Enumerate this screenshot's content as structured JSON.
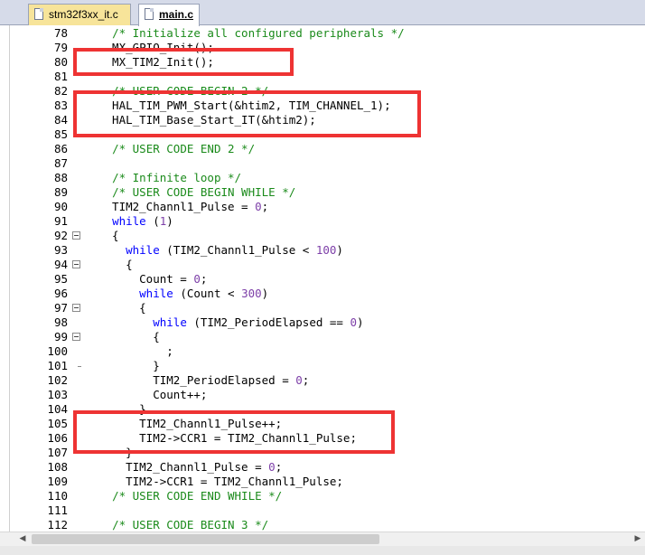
{
  "tabs": [
    {
      "label": "stm32f3xx_it.c",
      "active": false
    },
    {
      "label": "main.c",
      "active": true
    }
  ],
  "editor": {
    "lines": [
      {
        "num": "78",
        "fold": "",
        "segments": [
          {
            "t": "  ",
            "c": "plain"
          },
          {
            "t": "/* Initialize all configured peripherals */",
            "c": "comment"
          }
        ]
      },
      {
        "num": "79",
        "fold": "",
        "segments": [
          {
            "t": "  MX_GPIO_Init();",
            "c": "plain"
          }
        ]
      },
      {
        "num": "80",
        "fold": "",
        "segments": [
          {
            "t": "  MX_TIM2_Init();",
            "c": "plain"
          }
        ]
      },
      {
        "num": "81",
        "fold": "",
        "segments": [
          {
            "t": "",
            "c": "plain"
          }
        ]
      },
      {
        "num": "82",
        "fold": "",
        "segments": [
          {
            "t": "  ",
            "c": "plain"
          },
          {
            "t": "/* USER CODE BEGIN 2 */",
            "c": "comment"
          }
        ]
      },
      {
        "num": "83",
        "fold": "",
        "segments": [
          {
            "t": "  HAL_TIM_PWM_Start(&htim2, TIM_CHANNEL_1);",
            "c": "plain"
          }
        ]
      },
      {
        "num": "84",
        "fold": "",
        "segments": [
          {
            "t": "  HAL_TIM_Base_Start_IT(&htim2);",
            "c": "plain"
          }
        ]
      },
      {
        "num": "85",
        "fold": "",
        "segments": [
          {
            "t": "",
            "c": "plain"
          }
        ]
      },
      {
        "num": "86",
        "fold": "",
        "segments": [
          {
            "t": "  ",
            "c": "plain"
          },
          {
            "t": "/* USER CODE END 2 */",
            "c": "comment"
          }
        ]
      },
      {
        "num": "87",
        "fold": "",
        "segments": [
          {
            "t": "",
            "c": "plain"
          }
        ]
      },
      {
        "num": "88",
        "fold": "",
        "segments": [
          {
            "t": "  ",
            "c": "plain"
          },
          {
            "t": "/* Infinite loop */",
            "c": "comment"
          }
        ]
      },
      {
        "num": "89",
        "fold": "",
        "segments": [
          {
            "t": "  ",
            "c": "plain"
          },
          {
            "t": "/* USER CODE BEGIN WHILE */",
            "c": "comment"
          }
        ]
      },
      {
        "num": "90",
        "fold": "",
        "segments": [
          {
            "t": "  TIM2_Channl1_Pulse = ",
            "c": "plain"
          },
          {
            "t": "0",
            "c": "num"
          },
          {
            "t": ";",
            "c": "plain"
          }
        ]
      },
      {
        "num": "91",
        "fold": "",
        "segments": [
          {
            "t": "  ",
            "c": "plain"
          },
          {
            "t": "while",
            "c": "kw"
          },
          {
            "t": " (",
            "c": "plain"
          },
          {
            "t": "1",
            "c": "num"
          },
          {
            "t": ")",
            "c": "plain"
          }
        ]
      },
      {
        "num": "92",
        "fold": "open",
        "segments": [
          {
            "t": "  {",
            "c": "plain"
          }
        ]
      },
      {
        "num": "93",
        "fold": "",
        "segments": [
          {
            "t": "    ",
            "c": "plain"
          },
          {
            "t": "while",
            "c": "kw"
          },
          {
            "t": " (TIM2_Channl1_Pulse < ",
            "c": "plain"
          },
          {
            "t": "100",
            "c": "num"
          },
          {
            "t": ")",
            "c": "plain"
          }
        ]
      },
      {
        "num": "94",
        "fold": "open",
        "segments": [
          {
            "t": "    {",
            "c": "plain"
          }
        ]
      },
      {
        "num": "95",
        "fold": "",
        "segments": [
          {
            "t": "      Count = ",
            "c": "plain"
          },
          {
            "t": "0",
            "c": "num"
          },
          {
            "t": ";",
            "c": "plain"
          }
        ]
      },
      {
        "num": "96",
        "fold": "",
        "segments": [
          {
            "t": "      ",
            "c": "plain"
          },
          {
            "t": "while",
            "c": "kw"
          },
          {
            "t": " (Count < ",
            "c": "plain"
          },
          {
            "t": "300",
            "c": "num"
          },
          {
            "t": ")",
            "c": "plain"
          }
        ]
      },
      {
        "num": "97",
        "fold": "open",
        "segments": [
          {
            "t": "      {",
            "c": "plain"
          }
        ]
      },
      {
        "num": "98",
        "fold": "",
        "segments": [
          {
            "t": "        ",
            "c": "plain"
          },
          {
            "t": "while",
            "c": "kw"
          },
          {
            "t": " (TIM2_PeriodElapsed == ",
            "c": "plain"
          },
          {
            "t": "0",
            "c": "num"
          },
          {
            "t": ")",
            "c": "plain"
          }
        ]
      },
      {
        "num": "99",
        "fold": "open",
        "segments": [
          {
            "t": "        {",
            "c": "plain"
          }
        ]
      },
      {
        "num": "100",
        "fold": "",
        "segments": [
          {
            "t": "          ;",
            "c": "plain"
          }
        ]
      },
      {
        "num": "101",
        "fold": "end",
        "segments": [
          {
            "t": "        }",
            "c": "plain"
          }
        ]
      },
      {
        "num": "102",
        "fold": "",
        "segments": [
          {
            "t": "        TIM2_PeriodElapsed = ",
            "c": "plain"
          },
          {
            "t": "0",
            "c": "num"
          },
          {
            "t": ";",
            "c": "plain"
          }
        ]
      },
      {
        "num": "103",
        "fold": "",
        "segments": [
          {
            "t": "        Count++;",
            "c": "plain"
          }
        ]
      },
      {
        "num": "104",
        "fold": "",
        "segments": [
          {
            "t": "      }",
            "c": "plain"
          }
        ]
      },
      {
        "num": "105",
        "fold": "",
        "segments": [
          {
            "t": "      TIM2_Channl1_Pulse++;",
            "c": "plain"
          }
        ]
      },
      {
        "num": "106",
        "fold": "",
        "segments": [
          {
            "t": "      TIM2->CCR1 = TIM2_Channl1_Pulse;",
            "c": "plain"
          }
        ]
      },
      {
        "num": "107",
        "fold": "",
        "segments": [
          {
            "t": "    }",
            "c": "plain"
          }
        ]
      },
      {
        "num": "108",
        "fold": "",
        "segments": [
          {
            "t": "    TIM2_Channl1_Pulse = ",
            "c": "plain"
          },
          {
            "t": "0",
            "c": "num"
          },
          {
            "t": ";",
            "c": "plain"
          }
        ]
      },
      {
        "num": "109",
        "fold": "",
        "segments": [
          {
            "t": "    TIM2->CCR1 = TIM2_Channl1_Pulse;",
            "c": "plain"
          }
        ]
      },
      {
        "num": "110",
        "fold": "",
        "segments": [
          {
            "t": "  ",
            "c": "plain"
          },
          {
            "t": "/* USER CODE END WHILE */",
            "c": "comment"
          }
        ]
      },
      {
        "num": "111",
        "fold": "",
        "segments": [
          {
            "t": "",
            "c": "plain"
          }
        ]
      },
      {
        "num": "112",
        "fold": "",
        "segments": [
          {
            "t": "  ",
            "c": "plain"
          },
          {
            "t": "/* USER CODE BEGIN 3 */",
            "c": "comment"
          }
        ]
      }
    ]
  },
  "highlight_color": "#ee3333",
  "scrollbar": {
    "left_icon": "arrow-left-icon",
    "right_icon": "arrow-right-icon"
  }
}
